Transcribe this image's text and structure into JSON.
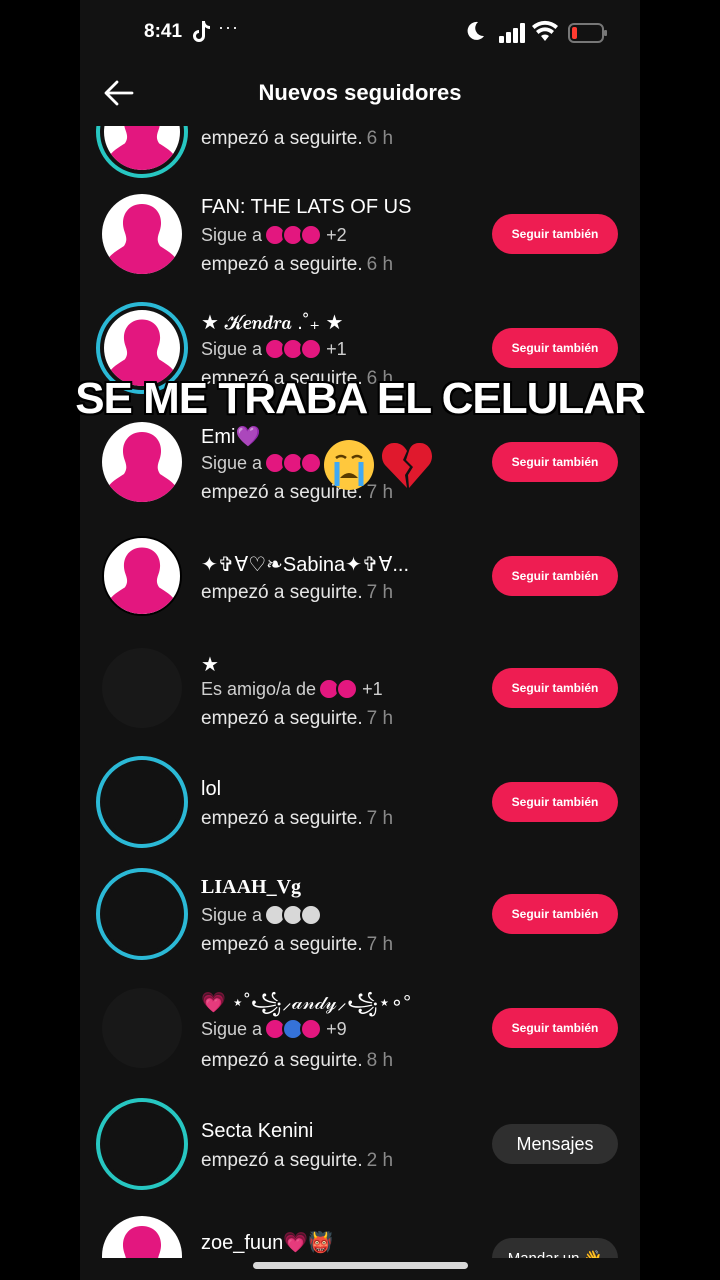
{
  "status_bar": {
    "time": "8:41",
    "dots": "···"
  },
  "header": {
    "title": "Nuevos seguidores"
  },
  "overlay": {
    "caption": "SE ME TRABA EL CELULAR"
  },
  "rows": [
    {
      "name": "",
      "subtitle": "",
      "action": "empezó a seguirte.",
      "time": "6 h",
      "button": ""
    },
    {
      "name": "FAN: THE LATS OF US",
      "subtitle": "Sigue a",
      "extra": "+2",
      "action": "empezó a seguirte.",
      "time": "6 h",
      "button": "Seguir también"
    },
    {
      "name": "★ 𝓚𝒆𝒏𝒅𝒓𝒂 .˚₊ ★",
      "subtitle": "Sigue a",
      "extra": "+1",
      "action": "empezó a seguirte.",
      "time": "6 h",
      "button": "Seguir también"
    },
    {
      "name": "Emi💜",
      "subtitle": "Sigue a",
      "extra": "",
      "action": "empezó a seguirte.",
      "time": "7 h",
      "button": "Seguir también"
    },
    {
      "name": "✦✞Ɐ♡❧Sabina✦✞Ɐ...",
      "subtitle": "",
      "action": "empezó a seguirte.",
      "time": "7 h",
      "button": "Seguir también"
    },
    {
      "name": "★",
      "subtitle": "Es amigo/a de",
      "extra": "+1",
      "action": "empezó a seguirte.",
      "time": "7 h",
      "button": "Seguir también"
    },
    {
      "name": "lol",
      "subtitle": "",
      "action": "empezó a seguirte.",
      "time": "7 h",
      "button": "Seguir también"
    },
    {
      "name": "LIAAH_Vg",
      "subtitle": "Sigue a",
      "extra": "",
      "action": "empezó a seguirte.",
      "time": "7 h",
      "button": "Seguir también"
    },
    {
      "name": "💗 ⋆˚꧁⸝𝒶𝓃𝒹𝓎⸝꧁⋆∘°",
      "subtitle": "Sigue a",
      "extra": "+9",
      "action": "empezó a seguirte.",
      "time": "8 h",
      "button": "Seguir también"
    },
    {
      "name": "Secta Kenini",
      "subtitle": "",
      "action": "empezó a seguirte.",
      "time": "2 h",
      "button": "Mensajes"
    },
    {
      "name": "zoe_fuun💗👹",
      "subtitle": "",
      "action": "",
      "time": "",
      "button": "Mandar un 👋"
    }
  ],
  "colors": {
    "accent": "#ee1d52",
    "ring": "#2bb9d6",
    "background": "#121212"
  },
  "icons": [
    "back-arrow-icon",
    "tiktok-icon",
    "moon-icon",
    "signal-icon",
    "wifi-icon",
    "battery-icon",
    "silhouette-avatar-icon",
    "crying-face-emoji-icon",
    "broken-heart-emoji-icon"
  ]
}
